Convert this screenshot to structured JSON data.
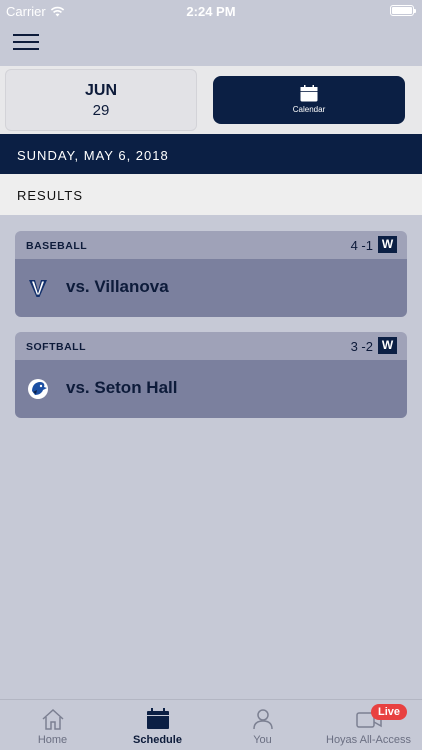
{
  "status_bar": {
    "carrier": "Carrier",
    "time": "2:24 PM"
  },
  "date_selector": {
    "month": "JUN",
    "day": "29"
  },
  "calendar_button": {
    "label": "Calendar"
  },
  "day_header": "SUNDAY, MAY 6, 2018",
  "section_title": "RESULTS",
  "games": [
    {
      "sport": "BASEBALL",
      "score": "4 -1",
      "result": "W",
      "opponent": "vs. Villanova"
    },
    {
      "sport": "SOFTBALL",
      "score": "3 -2",
      "result": "W",
      "opponent": "vs. Seton Hall"
    }
  ],
  "tabs": [
    {
      "label": "Home",
      "icon": "home-icon"
    },
    {
      "label": "Schedule",
      "icon": "calendar-icon"
    },
    {
      "label": "You",
      "icon": "person-icon"
    },
    {
      "label": "Hoyas All-Access",
      "icon": "video-icon"
    }
  ],
  "live_badge": "Live",
  "colors": {
    "navy": "#0b1f44",
    "card_top": "#9fa2b8",
    "card_body": "#7b809e",
    "live": "#e84141"
  }
}
